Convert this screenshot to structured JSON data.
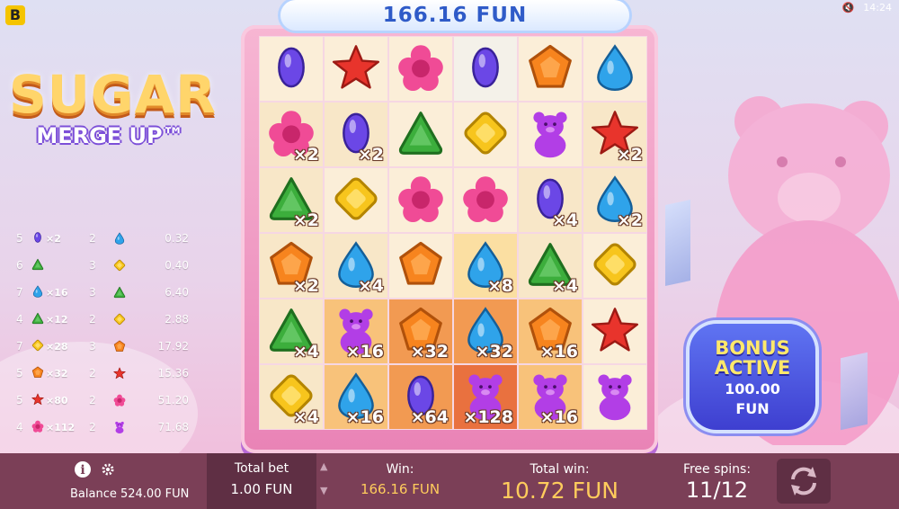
{
  "brand_letter": "B",
  "side_text": "SUGAR MERGE UP",
  "clock": "14:24",
  "logo": {
    "main": "SUGAR",
    "sub": "MERGE UP™"
  },
  "balance_display": "166.16 FUN",
  "paytable": [
    {
      "count": "5",
      "gem": "purple",
      "mult": "×2",
      "n": "2",
      "gem2": "blue",
      "value": "0.32"
    },
    {
      "count": "6",
      "gem": "green",
      "mult": "",
      "n": "3",
      "gem2": "yellow",
      "value": "0.40"
    },
    {
      "count": "7",
      "gem": "blue",
      "mult": "×16",
      "n": "3",
      "gem2": "green",
      "value": "6.40"
    },
    {
      "count": "4",
      "gem": "green",
      "mult": "×12",
      "n": "2",
      "gem2": "yellow",
      "value": "2.88"
    },
    {
      "count": "7",
      "gem": "yellow",
      "mult": "×28",
      "n": "3",
      "gem2": "orange",
      "value": "17.92"
    },
    {
      "count": "5",
      "gem": "orange",
      "mult": "×32",
      "n": "2",
      "gem2": "red",
      "value": "15.36"
    },
    {
      "count": "5",
      "gem": "red",
      "mult": "×80",
      "n": "2",
      "gem2": "pink",
      "value": "51.20"
    },
    {
      "count": "4",
      "gem": "pink",
      "mult": "×112",
      "n": "2",
      "gem2": "bear",
      "value": "71.68"
    }
  ],
  "grid": [
    [
      {
        "s": "purple",
        "m": "",
        "c": 0
      },
      {
        "s": "red",
        "m": "",
        "c": 0
      },
      {
        "s": "pink",
        "m": "",
        "c": 0
      },
      {
        "s": "purple",
        "m": "",
        "c": 6
      },
      {
        "s": "orange",
        "m": "",
        "c": 0
      },
      {
        "s": "blue",
        "m": "",
        "c": 0
      }
    ],
    [
      {
        "s": "pink",
        "m": "×2",
        "c": 1
      },
      {
        "s": "purple",
        "m": "×2",
        "c": 1
      },
      {
        "s": "green",
        "m": "",
        "c": 0
      },
      {
        "s": "yellow",
        "m": "",
        "c": 0
      },
      {
        "s": "bear",
        "m": "",
        "c": 0
      },
      {
        "s": "red",
        "m": "×2",
        "c": 1
      }
    ],
    [
      {
        "s": "green",
        "m": "×2",
        "c": 1
      },
      {
        "s": "yellow",
        "m": "",
        "c": 0
      },
      {
        "s": "pink",
        "m": "",
        "c": 0
      },
      {
        "s": "pink",
        "m": "",
        "c": 0
      },
      {
        "s": "purple",
        "m": "×4",
        "c": 1
      },
      {
        "s": "blue",
        "m": "×2",
        "c": 1
      }
    ],
    [
      {
        "s": "orange",
        "m": "×2",
        "c": 1
      },
      {
        "s": "blue",
        "m": "×4",
        "c": 1
      },
      {
        "s": "orange",
        "m": "",
        "c": 0
      },
      {
        "s": "blue",
        "m": "×8",
        "c": 2
      },
      {
        "s": "green",
        "m": "×4",
        "c": 1
      },
      {
        "s": "yellow",
        "m": "",
        "c": 0
      }
    ],
    [
      {
        "s": "green",
        "m": "×4",
        "c": 1
      },
      {
        "s": "bear",
        "m": "×16",
        "c": 3
      },
      {
        "s": "orange",
        "m": "×32",
        "c": 4
      },
      {
        "s": "blue",
        "m": "×32",
        "c": 4
      },
      {
        "s": "orange",
        "m": "×16",
        "c": 3
      },
      {
        "s": "red",
        "m": "",
        "c": 0
      }
    ],
    [
      {
        "s": "yellow",
        "m": "×4",
        "c": 1
      },
      {
        "s": "blue",
        "m": "×16",
        "c": 3
      },
      {
        "s": "purple",
        "m": "×64",
        "c": 4
      },
      {
        "s": "bear",
        "m": "×128",
        "c": 5
      },
      {
        "s": "bear",
        "m": "×16",
        "c": 3
      },
      {
        "s": "bear",
        "m": "",
        "c": 0
      }
    ]
  ],
  "bonus": {
    "title1": "BONUS",
    "title2": "ACTIVE",
    "amount": "100.00",
    "currency": "FUN"
  },
  "bottom": {
    "balance": "Balance 524.00 FUN",
    "total_bet_label": "Total bet",
    "total_bet_value": "1.00 FUN",
    "win_label": "Win:",
    "win_value": "166.16 FUN",
    "total_win_label": "Total win:",
    "total_win_value": "10.72 FUN",
    "free_spins_label": "Free spins:",
    "free_spins_value": "11/12"
  },
  "colors": {
    "purple": "#6b47e6",
    "red": "#e8342c",
    "pink": "#f04b96",
    "orange": "#f7841e",
    "blue": "#2fa3ea",
    "green": "#3cae3c",
    "yellow": "#f7c51d",
    "bear": "#b23ee6",
    "bottom_bar": "#7b3f57",
    "gold_text": "#ffcc5c"
  }
}
